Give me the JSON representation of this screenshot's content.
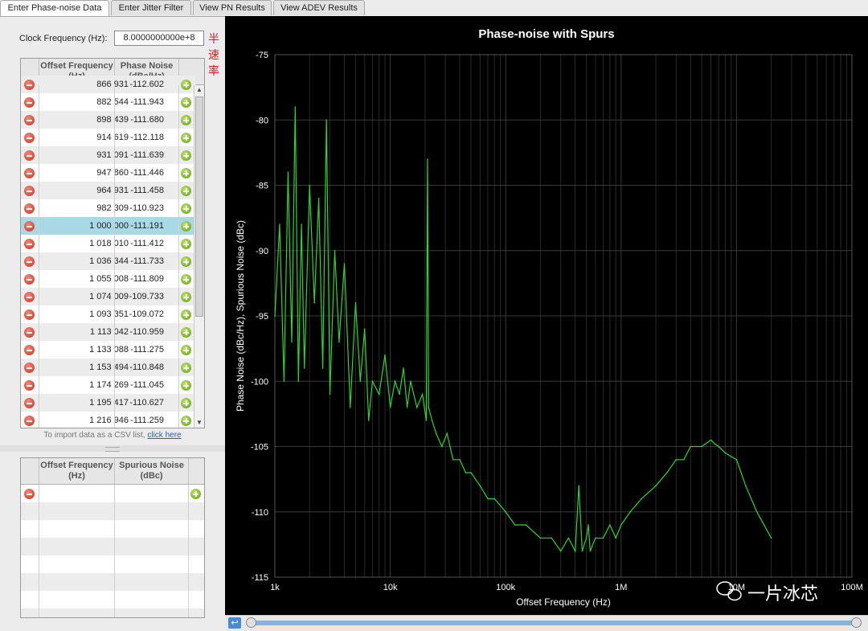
{
  "tabs": [
    {
      "label": "Enter Phase-noise Data",
      "active": true
    },
    {
      "label": "Enter Jitter Filter",
      "active": false
    },
    {
      "label": "View PN Results",
      "active": false
    },
    {
      "label": "View ADEV Results",
      "active": false
    }
  ],
  "clock": {
    "label": "Clock Frequency (Hz):",
    "value": "8.0000000000e+8",
    "note": "半速率"
  },
  "pn_table": {
    "headers": [
      "Offset Frequency (Hz)",
      "Phase Noise (dBc/Hz)"
    ],
    "rows": [
      [
        "866 931",
        "-112.602"
      ],
      [
        "882 544",
        "-111.943"
      ],
      [
        "898 439",
        "-111.680"
      ],
      [
        "914 619",
        "-112.118"
      ],
      [
        "931 091",
        "-111.639"
      ],
      [
        "947 860",
        "-111.446"
      ],
      [
        "964 931",
        "-111.458"
      ],
      [
        "982 309",
        "-110.923"
      ],
      [
        "1 000 000",
        "-111.191"
      ],
      [
        "1 018 010",
        "-111.412"
      ],
      [
        "1 036 344",
        "-111.733"
      ],
      [
        "1 055 008",
        "-111.809"
      ],
      [
        "1 074 009",
        "-109.733"
      ],
      [
        "1 093 351",
        "-109.072"
      ],
      [
        "1 113 042",
        "-110.959"
      ],
      [
        "1 133 088",
        "-111.275"
      ],
      [
        "1 153 494",
        "-110.848"
      ],
      [
        "1 174 269",
        "-111.045"
      ],
      [
        "1 195 417",
        "-110.627"
      ],
      [
        "1 216 946",
        "-111.259"
      ]
    ],
    "selected_index": 8
  },
  "import_hint": {
    "text": "To import data as a CSV list,",
    "link": "click here"
  },
  "spur_table": {
    "headers": [
      "Offset Frequency (Hz)",
      "Spurious Noise (dBc)"
    ],
    "rows": []
  },
  "watermark": "一片冰芯",
  "colors": {
    "trace": "#2fd52f",
    "grid": "#3a3a3a",
    "background": "#000000",
    "selected_row": "#a9d8e6"
  },
  "chart_data": {
    "type": "line",
    "title": "Phase-noise with Spurs",
    "xlabel": "Offset Frequency (Hz)",
    "ylabel": "Phase Noise (dBc/Hz), Spurious Noise (dBc)",
    "xscale": "log",
    "xlim": [
      1000,
      100000000
    ],
    "ylim": [
      -115,
      -75
    ],
    "xticks": [
      "1k",
      "10k",
      "100k",
      "1M",
      "10M",
      "100M"
    ],
    "yticks": [
      -75,
      -80,
      -85,
      -90,
      -95,
      -100,
      -105,
      -110,
      -115
    ],
    "grid": true,
    "series": [
      {
        "x": [
          1000,
          1100,
          1200,
          1300,
          1400,
          1500,
          1600,
          1700,
          1800,
          2000,
          2200,
          2400,
          2600,
          2800,
          3000,
          3300,
          3600,
          4000,
          4500,
          5000,
          5500,
          6000,
          6500,
          7000,
          8000,
          9000,
          10000,
          11000,
          12000,
          13000,
          14000,
          15000,
          17000,
          19000,
          20500,
          21000,
          21500,
          23000,
          25000,
          28000,
          31000,
          35000,
          40000,
          45000,
          50000,
          60000,
          70000,
          80000,
          100000,
          120000,
          150000,
          200000,
          250000,
          300000,
          350000,
          400000,
          430000,
          460000,
          500000,
          520000,
          540000,
          600000,
          700000,
          800000,
          900000,
          1000000,
          1200000,
          1500000,
          2000000,
          2500000,
          3000000,
          3500000,
          4000000,
          5000000,
          6000000,
          6500000,
          7000000,
          8000000,
          10000000,
          12000000,
          15000000,
          20000000
        ],
        "y": [
          -95,
          -88,
          -100,
          -84,
          -97,
          -79,
          -100,
          -88,
          -99,
          -85,
          -94,
          -86,
          -99,
          -80,
          -101,
          -90,
          -97,
          -91,
          -102,
          -94,
          -100,
          -96,
          -103,
          -100,
          -101,
          -98,
          -102,
          -100,
          -101,
          -99,
          -102,
          -100,
          -102,
          -101,
          -103,
          -83,
          -102,
          -103,
          -104,
          -105,
          -104,
          -106,
          -106,
          -107,
          -107,
          -108,
          -109,
          -109,
          -110,
          -111,
          -111,
          -112,
          -112,
          -113,
          -112,
          -113,
          -108,
          -113,
          -112,
          -111,
          -113,
          -112,
          -112,
          -111,
          -112,
          -111,
          -110,
          -109,
          -108,
          -107,
          -106,
          -106,
          -105,
          -105,
          -104.5,
          -104.8,
          -105,
          -105.5,
          -106,
          -108,
          -110,
          -112
        ]
      }
    ]
  }
}
